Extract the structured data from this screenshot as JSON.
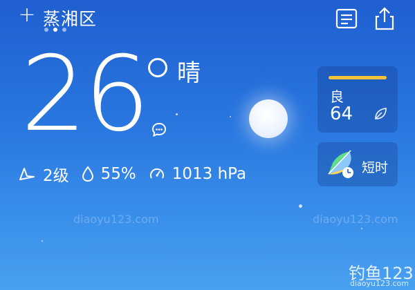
{
  "header": {
    "add_label": "+",
    "city": "蒸湘区",
    "page_dots": 3,
    "active_dot": 1
  },
  "weather": {
    "temperature": "26",
    "condition": "晴"
  },
  "stats": {
    "wind": "2级",
    "humidity": "55%",
    "pressure": "1013 hPa"
  },
  "aqi_card": {
    "label": "良",
    "value": "64",
    "bar_color": "#f2c23a"
  },
  "short_card": {
    "label": "短时"
  },
  "watermark": {
    "brand": "钓鱼123",
    "url": "diaoyu123.com"
  },
  "icons": [
    "list-icon",
    "share-icon",
    "chat-bubble-icon",
    "wind-icon",
    "humidity-icon",
    "pressure-icon",
    "leaf-icon",
    "umbrella-clock-icon"
  ]
}
